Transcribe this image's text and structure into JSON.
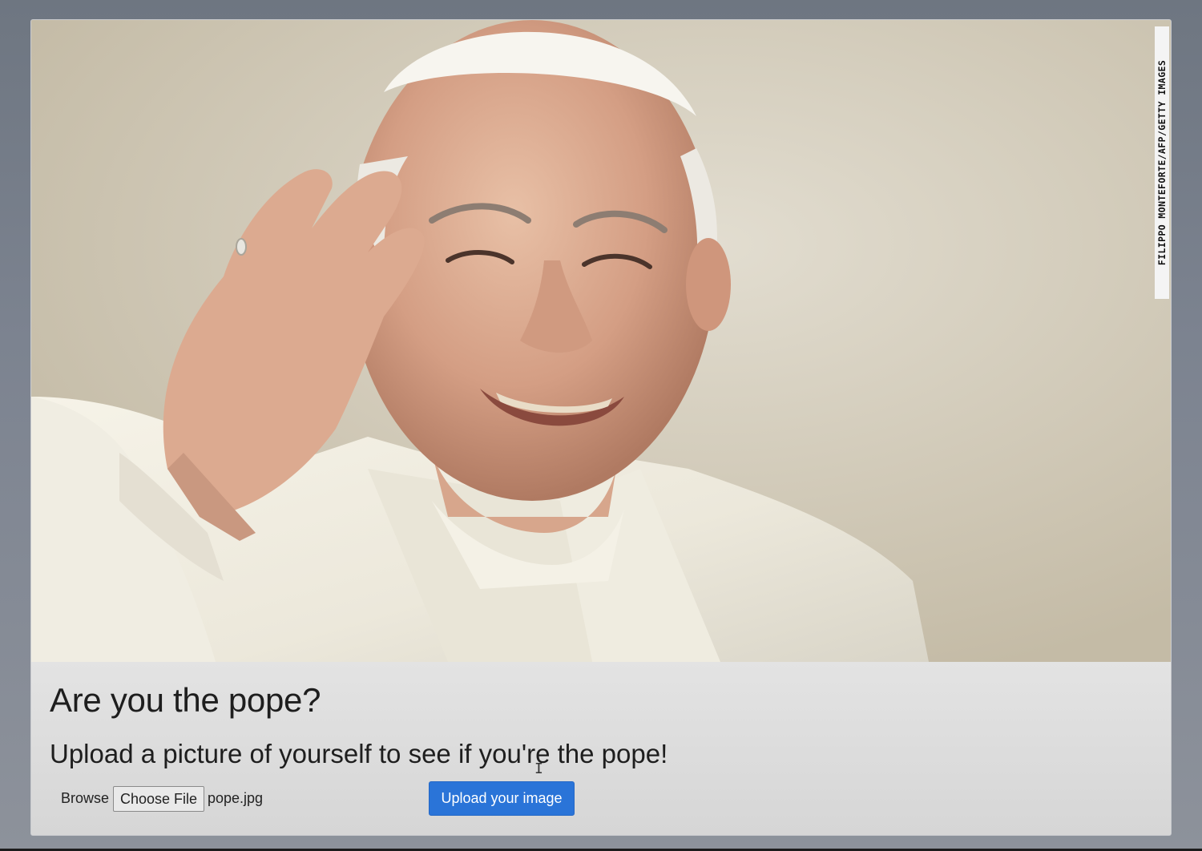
{
  "photo": {
    "credit": "FILIPPO MONTEFORTE/AFP/GETTY IMAGES"
  },
  "content": {
    "title": "Are you the pope?",
    "subtitle": "Upload a picture of yourself to see if you're the pope!",
    "browse_label": "Browse",
    "choose_file_label": "Choose File",
    "file_name": "pope.jpg",
    "upload_button_label": "Upload your image"
  },
  "colors": {
    "page_background": "#7c8390",
    "panel_background": "#dcdcdc",
    "upload_button": "#2a74d8",
    "heading_text": "#1e1e1e"
  },
  "icons": {
    "cursor": "text-cursor-icon"
  }
}
